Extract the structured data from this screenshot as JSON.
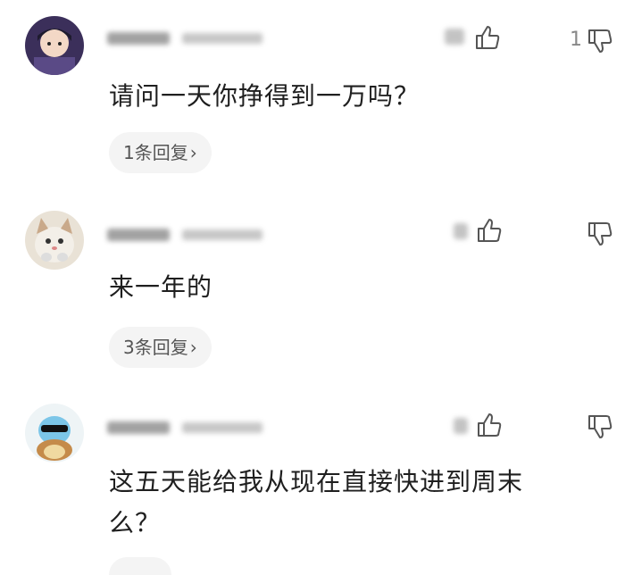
{
  "comments": [
    {
      "text": "请问一天你挣得到一万吗？",
      "reply_label": "1条回复",
      "dislike_count": "1"
    },
    {
      "text": "来一年的",
      "reply_label": "3条回复",
      "dislike_count": ""
    },
    {
      "text_line1": "这五天能给我从现在直接快进到周末",
      "text_line2": "么？",
      "reply_label": "",
      "dislike_count": ""
    }
  ],
  "icons": {
    "like": "thumb-up-icon",
    "dislike": "thumb-down-icon",
    "chevron": "chevron-right-icon"
  }
}
